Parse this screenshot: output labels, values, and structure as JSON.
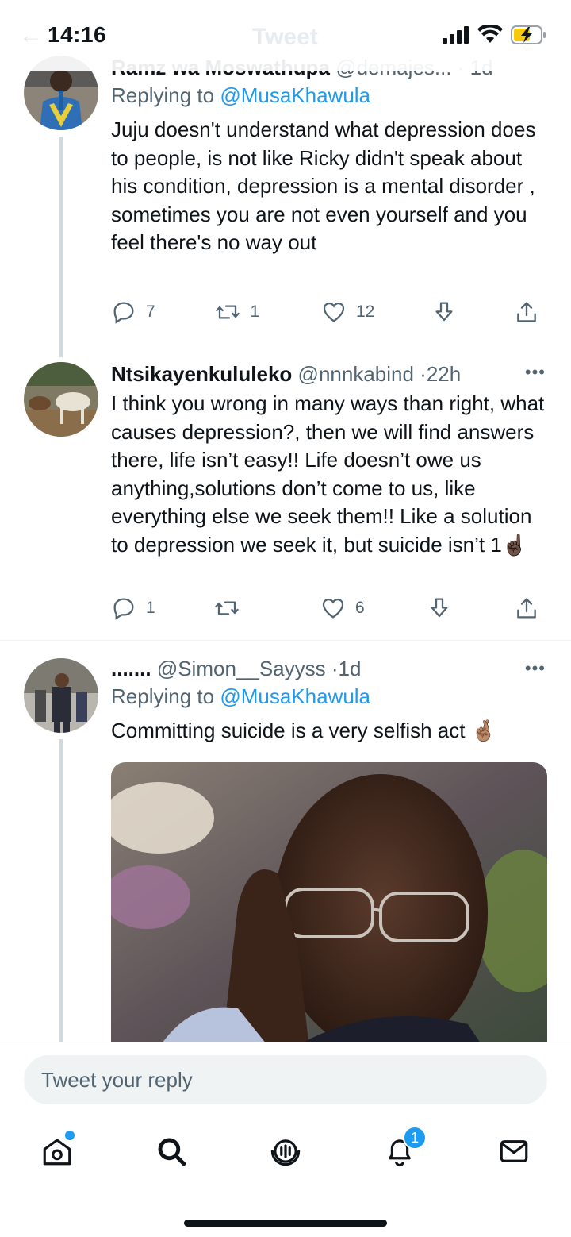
{
  "status_bar": {
    "time": "14:16"
  },
  "header": {
    "title": "Tweet"
  },
  "tweets": [
    {
      "name": "Ramz wa Moswathupa",
      "handle": "@demajes...",
      "time": "1d",
      "replying_prefix": "Replying to",
      "replying_to": "@MusaKhawula",
      "text": "Juju doesn't understand what depression does to people,  is not like Ricky didn't speak about his condition,  depression is a mental disorder , sometimes you are not even yourself and you feel there's no way out",
      "replies": "7",
      "retweets": "1",
      "likes": "12"
    },
    {
      "name": "Ntsikayenkululeko",
      "handle": "@nnnkabind",
      "time": "22h",
      "text": "I think you wrong in many ways than right, what causes depression?, then we will find answers there, life isn’t easy!! Life doesn’t owe us anything,solutions don’t come to us, like everything else we seek them!! Like a solution to depression we seek it, but suicide isn’t 1☝🏿",
      "replies": "1",
      "retweets": "",
      "likes": "6"
    },
    {
      "name": ".......",
      "handle": "@Simon__Sayyss",
      "time": "1d",
      "replying_prefix": "Replying to",
      "replying_to": "@MusaKhawula",
      "text": "Committing suicide is a very selfish act 🤞🏽"
    }
  ],
  "reply_bar": {
    "placeholder": "Tweet your reply"
  },
  "nav": {
    "notifications_badge": "1"
  },
  "colors": {
    "accent": "#1d9bf0",
    "text": "#0f1419",
    "muted": "#536471",
    "thread_line": "#cfd9de"
  },
  "icons": [
    "reply-icon",
    "retweet-icon",
    "like-icon",
    "bookmark-icon",
    "share-icon",
    "home-icon",
    "search-icon",
    "spaces-icon",
    "notifications-icon",
    "messages-icon"
  ]
}
